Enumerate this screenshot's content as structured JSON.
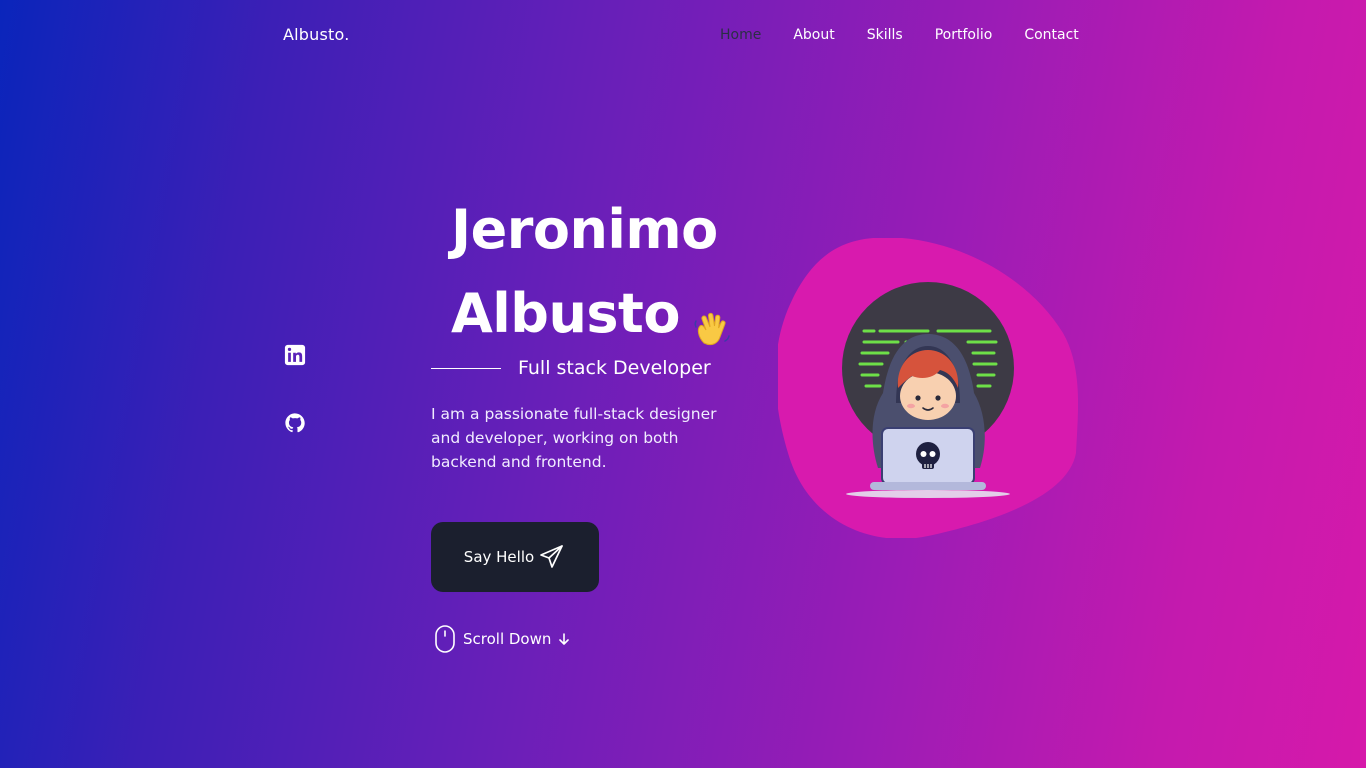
{
  "header": {
    "logo": "Albusto.",
    "nav": [
      {
        "label": "Home",
        "active": true
      },
      {
        "label": "About",
        "active": false
      },
      {
        "label": "Skills",
        "active": false
      },
      {
        "label": "Portfolio",
        "active": false
      },
      {
        "label": "Contact",
        "active": false
      }
    ]
  },
  "social": [
    {
      "icon": "linkedin-icon"
    },
    {
      "icon": "github-icon"
    }
  ],
  "hero": {
    "first_name": "Jeronimo",
    "last_name": "Albusto",
    "subtitle": "Full stack Developer",
    "description": "I am a passionate full-stack designer and developer, working on both backend and frontend.",
    "button_label": "Say Hello",
    "scroll_label": "Scroll Down"
  },
  "colors": {
    "gradient_start": "#0a25bb",
    "gradient_end": "#d619aa",
    "active_nav": "#2b2f45",
    "button_bg": "#1b1f2e",
    "blob": "#d81aae"
  }
}
